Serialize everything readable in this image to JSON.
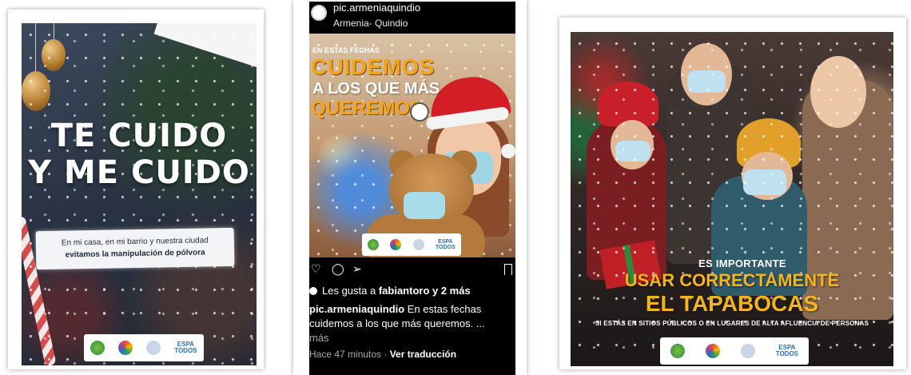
{
  "card1": {
    "title_line1": "TE CUIDO",
    "title_line2": "Y ME CUIDO",
    "banner_line1": "En mi casa, en mi barrio y nuestra ciudad",
    "banner_line2": "evitamos la manipulación de pólvora",
    "logo_espa": "ESPA",
    "logo_todos": "TODOS"
  },
  "card2": {
    "username": "pic.armeniaquindio",
    "location": "Armenia- Quindio",
    "post": {
      "pre": "EN ESTAS FECHAS",
      "line1": "CUIDEMOS",
      "line2": "A LOS QUE MÁS",
      "line3": "QUEREMOS",
      "logo_espa": "ESPA",
      "logo_todos": "TODOS"
    },
    "likes_prefix": "Les gusta a ",
    "likes_user": "fabiantoro",
    "likes_suffix": " y 2 más",
    "caption_user": "pic.armeniaquindio",
    "caption_text": " En estas fechas cuidemos a los que más queremos. ...",
    "caption_more": "más",
    "time": "Hace 47 minutos",
    "separator": " · ",
    "translate": "Ver traducción"
  },
  "card3": {
    "line1": "ES IMPORTANTE",
    "line2": "USAR CORRECTAMENTE",
    "line3": "EL TAPABOCAS",
    "line4": "SI ESTÁS EN SITIOS PÚBLICOS O EN LUGARES DE ALTA AFLUENCIA DE PERSONAS",
    "logo_espa": "ESPA",
    "logo_todos": "TODOS"
  }
}
